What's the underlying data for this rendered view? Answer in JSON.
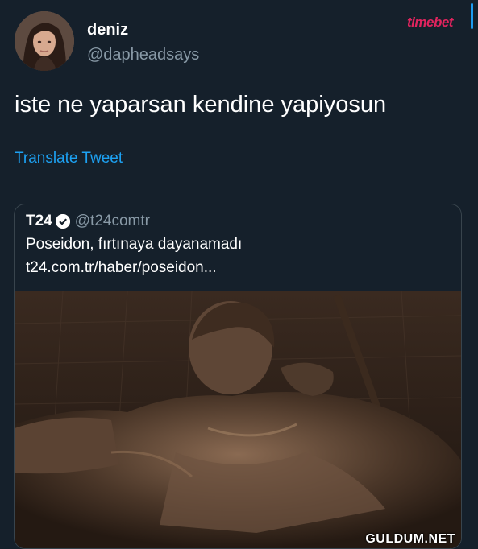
{
  "user": {
    "name": "deniz",
    "handle": "@dapheadsays"
  },
  "brand": {
    "logo_text": "timebet",
    "logo_color": "#e0245e"
  },
  "tweet": {
    "text": "iste ne yaparsan kendine yapiyosun",
    "translate_label": "Translate Tweet"
  },
  "quoted_tweet": {
    "name": "T24",
    "verified_icon": "verified-badge-icon",
    "handle": "@t24comtr",
    "text": "Poseidon, fırtınaya dayanamadı",
    "link": "t24.com.tr/haber/poseidon..."
  },
  "watermark": "GULDUM.NET",
  "colors": {
    "background": "#15202b",
    "link": "#1da1f2",
    "secondary_text": "#8899a6",
    "border": "#38444d"
  }
}
